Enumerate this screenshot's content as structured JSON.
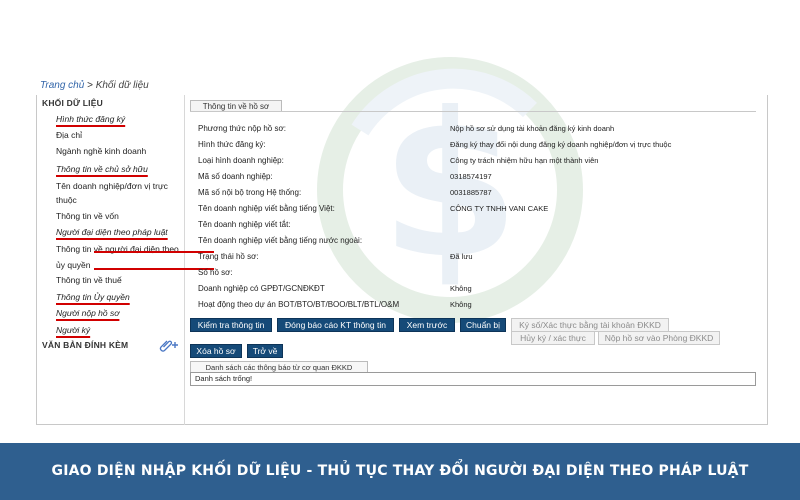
{
  "breadcrumb": {
    "home": "Trang chủ",
    "separator": ">",
    "current": "Khối dữ liệu"
  },
  "sidebar": {
    "section_title": "KHỐI DỮ LIỆU",
    "items": [
      {
        "label": "Hình thức đăng ký",
        "marked": true
      },
      {
        "label": "Địa chỉ",
        "marked": false
      },
      {
        "label": "Ngành nghề kinh doanh",
        "marked": false
      },
      {
        "label": "Thông tin về chủ sở hữu",
        "marked": true
      },
      {
        "label": "Tên doanh nghiệp/đơn vị trực thuộc",
        "marked": false
      },
      {
        "label": "Thông tin về vốn",
        "marked": false
      },
      {
        "label": "Người đại diện theo pháp luật",
        "marked": true
      },
      {
        "label": "Thông tin về người đại diện theo ủy quyền",
        "marked": true
      },
      {
        "label": "Thông tin về thuế",
        "marked": false
      },
      {
        "label": "Thông tin Ủy quyền",
        "marked": true
      },
      {
        "label": "Người nộp hồ sơ",
        "marked": true
      },
      {
        "label": "Người ký",
        "marked": true
      }
    ],
    "attachments_title": "VĂN BẢN ĐÍNH KÈM",
    "attach_icon": "paperclip-plus-icon"
  },
  "panel": {
    "tab_label": "Thông tin về hồ sơ",
    "rows": [
      {
        "label": "Phương thức nộp hồ sơ:",
        "value": "Nộp hồ sơ sử dụng tài khoản đăng ký kinh doanh"
      },
      {
        "label": "Hình thức đăng ký:",
        "value": "Đăng ký thay đổi nội dung đăng ký doanh nghiệp/đơn vị trực thuộc"
      },
      {
        "label": "Loại hình doanh nghiệp:",
        "value": "Công ty trách nhiệm hữu hạn một thành viên"
      },
      {
        "label": "Mã số doanh nghiệp:",
        "value": "0318574197"
      },
      {
        "label": "Mã số nội bộ trong Hệ thống:",
        "value": "0031885787"
      },
      {
        "label": "Tên doanh nghiệp viết bằng tiếng Việt:",
        "value": "CÔNG TY TNHH VANI CAKE"
      },
      {
        "label": "Tên doanh nghiệp viết tắt:",
        "value": ""
      },
      {
        "label": "Tên doanh nghiệp viết bằng tiếng nước ngoài:",
        "value": ""
      },
      {
        "label": "Trạng thái hồ sơ:",
        "value": "Đã lưu"
      },
      {
        "label": "Số hồ sơ:",
        "value": ""
      },
      {
        "label": "Doanh nghiệp có GPĐT/GCNĐKĐT",
        "value": "Không"
      },
      {
        "label": "Hoạt động theo dự án BOT/BTO/BT/BOO/BLT/BTL/O&M",
        "value": "Không"
      }
    ]
  },
  "buttons": {
    "check_info": "Kiểm tra thông tin",
    "close_report": "Đóng báo cáo KT thông tin",
    "preview": "Xem trước",
    "prepare": "Chuẩn bị",
    "sign_account": "Ký số/Xác thực bằng tài khoản ĐKKD",
    "cancel_sign": "Hủy ký / xác thực",
    "submit": "Nộp hồ sơ vào Phòng ĐKKD",
    "delete": "Xóa hồ sơ",
    "back": "Trở về"
  },
  "notices": {
    "tab_label": "Danh sách các thông báo từ cơ quan ĐKKD",
    "empty_text": "Danh sách trống!"
  },
  "banner": {
    "text": "GIAO DIỆN NHẬP KHỐI DỮ LIỆU - THỦ TỤC THAY ĐỔI NGƯỜI ĐẠI DIỆN THEO PHÁP LUẬT"
  },
  "colors": {
    "button_dark": "#154a78",
    "underline_red": "#d10000",
    "banner_bg": "#2f5f8f",
    "link_blue": "#3366aa"
  }
}
